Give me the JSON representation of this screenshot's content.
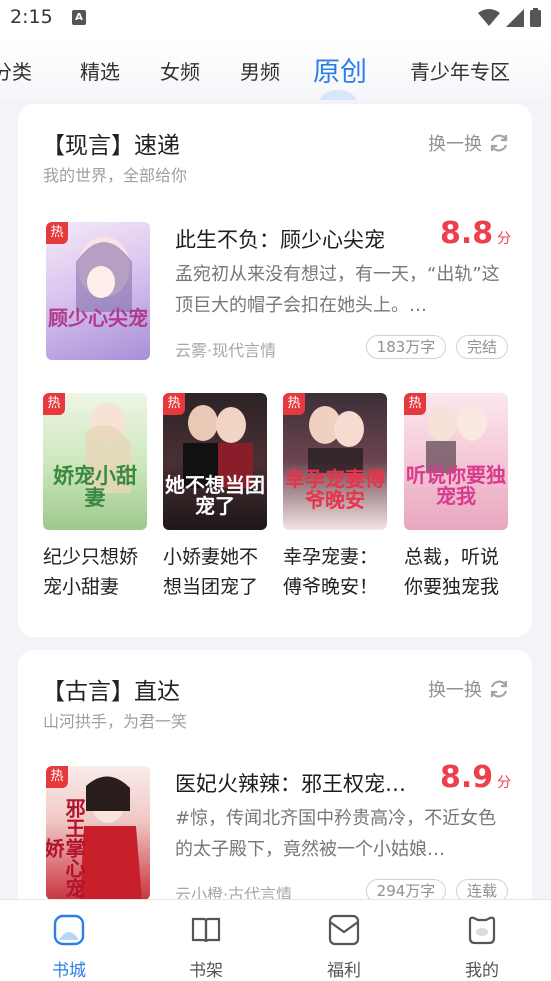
{
  "status_bar": {
    "time": "2:15",
    "notif_letter": "A"
  },
  "top_tabs": [
    {
      "label": "分类"
    },
    {
      "label": "精选"
    },
    {
      "label": "女频"
    },
    {
      "label": "男频"
    },
    {
      "label": "原创",
      "active": true
    },
    {
      "label": "青少年专区"
    }
  ],
  "section1": {
    "title": "【现言】速递",
    "subtitle": "我的世界，全部给你",
    "refresh_label": "换一换",
    "featured": {
      "hot_tag": "热",
      "cover_text": "顾少心尖宠",
      "title": "此生不负：顾少心尖宠",
      "score": "8.8",
      "score_unit": "分",
      "desc": "孟宛初从来没有想过，有一天，“出轨”这顶巨大的帽子会扣在她头上。…",
      "meta": "云雾·现代言情",
      "word_count": "183万字",
      "status": "完结"
    },
    "grid": [
      {
        "hot_tag": "热",
        "cover_text": "娇宠小甜妻",
        "title": "纪少只想娇宠小甜妻"
      },
      {
        "hot_tag": "热",
        "cover_text": "她不想当团宠了",
        "title": "小娇妻她不想当团宠了"
      },
      {
        "hot_tag": "热",
        "cover_text": "幸孕宠妻傅爷晚安",
        "title": "幸孕宠妻：傅爷晚安！"
      },
      {
        "hot_tag": "热",
        "cover_text": "听说你要独宠我",
        "title": "总裁，听说你要独宠我"
      }
    ]
  },
  "section2": {
    "title": "【古言】直达",
    "subtitle": "山河拱手，为君一笑",
    "refresh_label": "换一换",
    "featured": {
      "hot_tag": "热",
      "cover_text": "邪王掌心宠娇",
      "title": "医妃火辣辣：邪王权宠…",
      "score": "8.9",
      "score_unit": "分",
      "desc": "#惊，传闻北齐国中矜贵高冷，不近女色的太子殿下，竟然被一个小姑娘…",
      "meta": "云小橙·古代言情",
      "word_count": "294万字",
      "status": "连载"
    }
  },
  "bottom_nav": [
    {
      "label": "书城",
      "active": true
    },
    {
      "label": "书架"
    },
    {
      "label": "福利"
    },
    {
      "label": "我的"
    }
  ],
  "colors": {
    "accent": "#2d7fe6",
    "score_red": "#ee3f4d",
    "hot_tag": "#e6393e"
  }
}
